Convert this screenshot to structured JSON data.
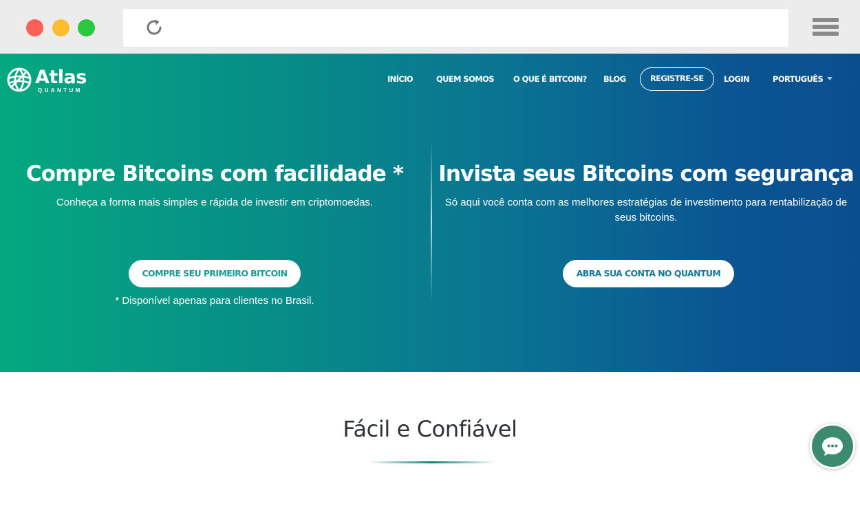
{
  "browser": {
    "reload_icon": "reload-icon",
    "menu_icon": "hamburger-menu-icon"
  },
  "brand": {
    "name": "Atlas",
    "subname": "QUANTUM",
    "logo_icon": "globe-icon"
  },
  "nav": {
    "items": [
      "INÍCIO",
      "QUEM SOMOS",
      "O QUE É BITCOIN?",
      "BLOG",
      "REGISTRE-SE",
      "LOGIN",
      "PORTUGUÊS"
    ]
  },
  "hero": {
    "left": {
      "title": "Compre Bitcoins com facilidade *",
      "subtitle": "Conheça a forma mais simples e rápida de investir em criptomoedas.",
      "button": "COMPRE SEU PRIMEIRO BITCOIN",
      "note": "* Disponível apenas para clientes no Brasil."
    },
    "right": {
      "title": "Invista seus Bitcoins com segurança",
      "subtitle": "Só aqui você conta com as melhores estratégias de investimento para rentabilização de seus bitcoins.",
      "button": "ABRA SUA CONTA NO QUANTUM"
    }
  },
  "section": {
    "title": "Fácil e Confiável"
  },
  "chat": {
    "icon": "chat-bubble-icon"
  },
  "colors": {
    "gradient_start": "#04a880",
    "gradient_end": "#0b4e8e",
    "button_text": "#1a9c93",
    "chat_green": "#3d8b6f"
  }
}
